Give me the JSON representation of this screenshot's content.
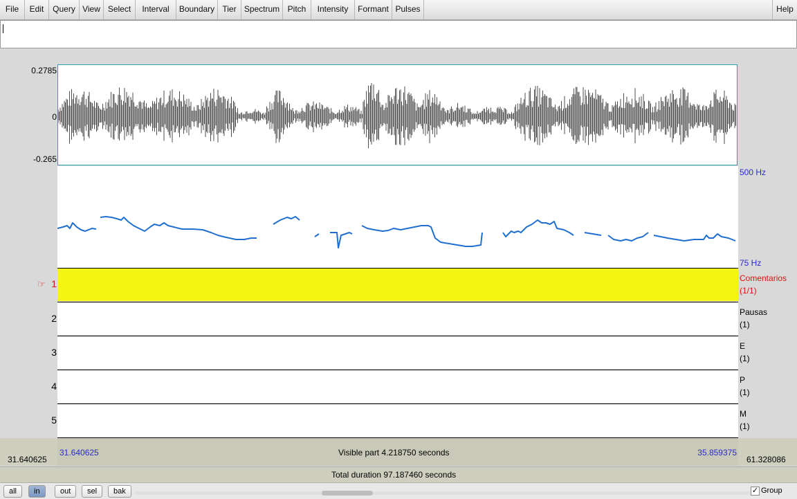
{
  "menu": [
    "File",
    "Edit",
    "Query",
    "View",
    "Select",
    "Interval",
    "Boundary",
    "Tier",
    "Spectrum",
    "Pitch",
    "Intensity",
    "Formant",
    "Pulses"
  ],
  "help": "Help",
  "waveform": {
    "ymax": "0.2785",
    "yzero": "0",
    "ymin": "-0.265"
  },
  "pitch": {
    "top": "500 Hz",
    "bottom": "75 Hz",
    "color": "#1f6fd0"
  },
  "tiers": [
    {
      "num": "1",
      "name": "Comentarios",
      "count": "(1/1)",
      "selected": true
    },
    {
      "num": "2",
      "name": "Pausas",
      "count": "(1)"
    },
    {
      "num": "3",
      "name": "E",
      "count": "(1)"
    },
    {
      "num": "4",
      "name": "P",
      "count": "(1)"
    },
    {
      "num": "5",
      "name": "M",
      "count": "(1)"
    }
  ],
  "tier_pointer_icon": "pointing-hand-icon",
  "time": {
    "left_outer": "31.640625",
    "left_inner": "31.640625",
    "visible": "Visible part 4.218750 seconds",
    "right_inner": "35.859375",
    "right_outer": "61.328086",
    "total": "Total duration 97.187460 seconds"
  },
  "buttons": {
    "all": "all",
    "in": "in",
    "out": "out",
    "sel": "sel",
    "bak": "bak"
  },
  "group_label": "Group"
}
